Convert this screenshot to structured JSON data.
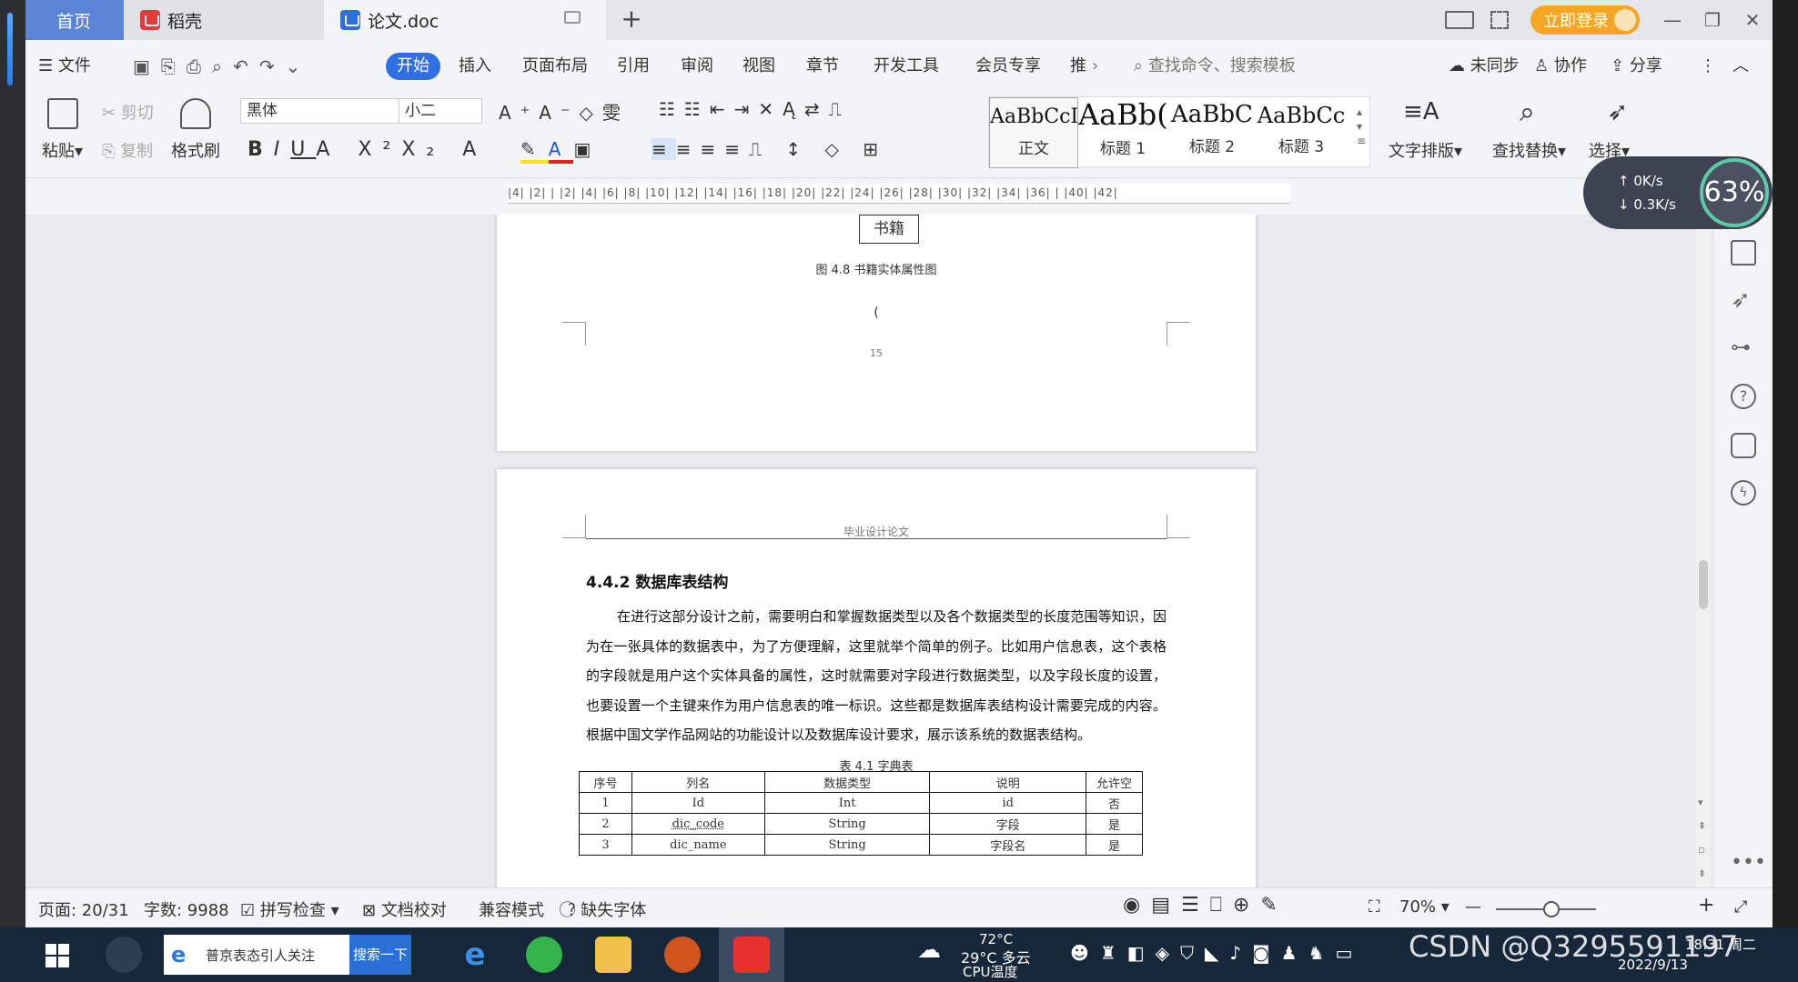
{
  "tabs": {
    "home": "首页",
    "daoke": "稻壳",
    "doc": "论文.doc"
  },
  "window": {
    "login": "立即登录"
  },
  "menu": {
    "file": "文件",
    "items": [
      "开始",
      "插入",
      "页面布局",
      "引用",
      "审阅",
      "视图",
      "章节",
      "开发工具",
      "会员专享",
      "推"
    ],
    "search_placeholder": "查找命令、搜索模板",
    "sync": "未同步",
    "collab": "协作",
    "share": "分享"
  },
  "ribbon": {
    "paste": "粘贴",
    "cut": "剪切",
    "copy": "复制",
    "format_painter": "格式刷",
    "font": "黑体",
    "size": "小二",
    "styles": [
      {
        "preview": "AaBbCcI",
        "name": "正文"
      },
      {
        "preview": "AaBb(",
        "name": "标题 1"
      },
      {
        "preview": "AaBbC",
        "name": "标题 2"
      },
      {
        "preview": "AaBbCc",
        "name": "标题 3"
      }
    ],
    "text_layout": "文字排版",
    "find_replace": "查找替换",
    "select": "选择"
  },
  "ruler": "|4| |2| | |2| |4| |6| |8| |10| |12| |14| |16| |18| |20| |22| |24| |26| |28| |30| |32| |34| |36| | |40| |42|",
  "doc": {
    "entity_label": "书籍",
    "figure_caption": "图 4.8  书籍实体属性图",
    "paren": "(",
    "page_number": "15",
    "header": "毕业设计论文",
    "section_title": "4.4.2  数据库表结构",
    "paragraph": "在进行这部分设计之前，需要明白和掌握数据类型以及各个数据类型的长度范围等知识，因为在一张具体的数据表中，为了方便理解，这里就举个简单的例子。比如用户信息表，这个表格的字段就是用户这个实体具备的属性，这时就需要对字段进行数据类型，以及字段长度的设置，也要设置一个主键来作为用户信息表的唯一标识。这些都是数据库表结构设计需要完成的内容。根据中国文学作品网站的功能设计以及数据库设计要求，展示该系统的数据表结构。",
    "table_caption": "表 4.1 字典表",
    "table_headers": [
      "序号",
      "列名",
      "数据类型",
      "说明",
      "允许空"
    ],
    "table_rows": [
      [
        "1",
        "Id",
        "Int",
        "id",
        "否"
      ],
      [
        "2",
        "dic_code",
        "String",
        "字段",
        "是"
      ],
      [
        "3",
        "dic_name",
        "String",
        "字段名",
        "是"
      ]
    ]
  },
  "netmeter": {
    "up": "0K/s",
    "down": "0.3K/s",
    "percent": "63%"
  },
  "status": {
    "page": "页面: 20/31",
    "words": "字数: 9988",
    "spell": "拼写检查",
    "proof": "文档校对",
    "compat": "兼容模式",
    "missing_font": "缺失字体",
    "zoom": "70%",
    "zoom_fraction": 0.55
  },
  "taskbar": {
    "search_text": "普京表态引人关注",
    "search_btn": "搜索一下",
    "weather_temp": "72°C",
    "weather": "29°C 多云",
    "cpu": "CPU温度",
    "time": "18:31 周二",
    "date": "2022/9/13"
  },
  "watermark": "CSDN @Q3295591197"
}
